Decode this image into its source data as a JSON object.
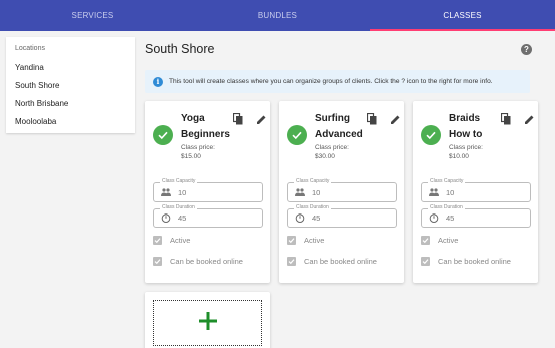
{
  "nav": {
    "tabs": [
      {
        "label": "SERVICES"
      },
      {
        "label": "BUNDLES"
      },
      {
        "label": "CLASSES"
      }
    ]
  },
  "sidebar": {
    "header": "Locations",
    "items": [
      {
        "label": "Yandina"
      },
      {
        "label": "South Shore"
      },
      {
        "label": "North Brisbane"
      },
      {
        "label": "Mooloolaba"
      }
    ]
  },
  "page": {
    "title": "South Shore",
    "help_label": "?"
  },
  "info_banner": {
    "icon_glyph": "i",
    "text": "This tool will create classes where you can organize groups of clients. Click the ? icon to the right for more info."
  },
  "cards": [
    {
      "title_line1": "Yoga",
      "title_line2": "Beginners",
      "price_label": "Class price:",
      "price": "$15.00",
      "capacity_label": "Class Capacity",
      "capacity": "10",
      "duration_label": "Class Duration",
      "duration": "45",
      "active_label": "Active",
      "online_label": "Can be booked online"
    },
    {
      "title_line1": "Surfing",
      "title_line2": "Advanced",
      "price_label": "Class price:",
      "price": "$30.00",
      "capacity_label": "Class Capacity",
      "capacity": "10",
      "duration_label": "Class Duration",
      "duration": "45",
      "active_label": "Active",
      "online_label": "Can be booked online"
    },
    {
      "title_line1": "Braids",
      "title_line2": "How to",
      "price_label": "Class price:",
      "price": "$10.00",
      "capacity_label": "Class Capacity",
      "capacity": "10",
      "duration_label": "Class Duration",
      "duration": "45",
      "active_label": "Active",
      "online_label": "Can be booked online"
    }
  ],
  "colors": {
    "nav_bar": "#3f4db1",
    "tab_indicator": "#ff3d73",
    "check_green": "#4caf50",
    "add_plus_green": "#1e8e2a",
    "info_blue": "#2f8bd6"
  }
}
